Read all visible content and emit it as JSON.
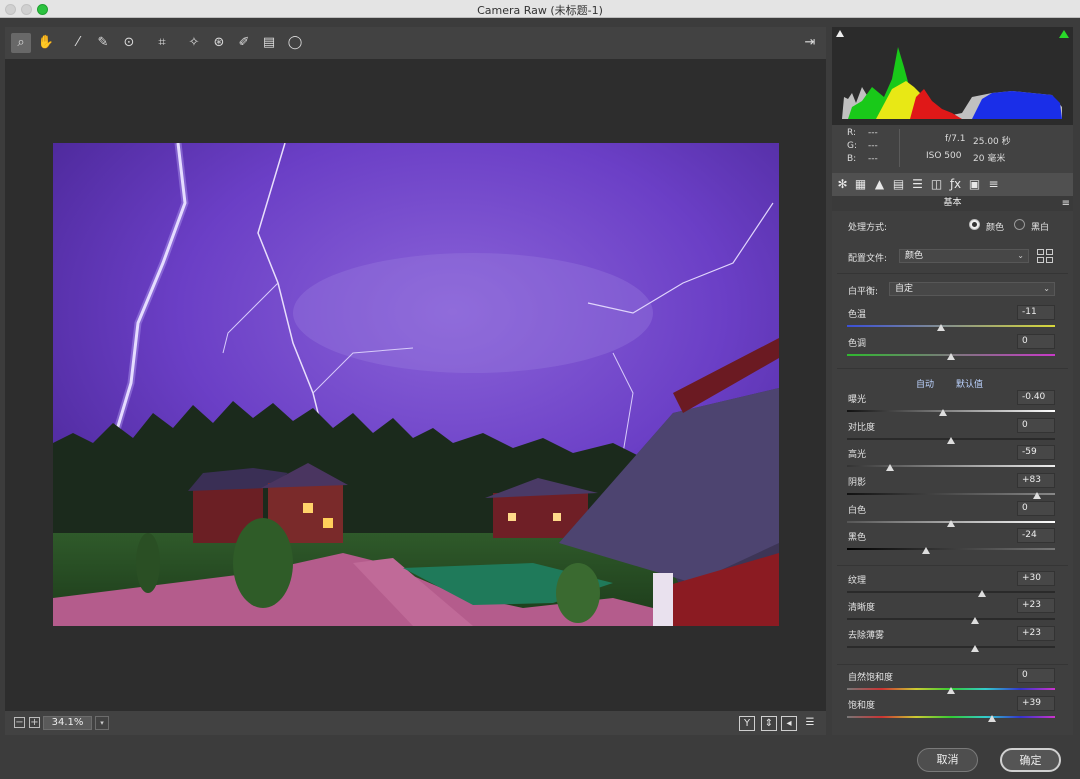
{
  "window": {
    "title": "Camera Raw (未标题-1)"
  },
  "tools": [
    {
      "name": "zoom-tool",
      "glyph": "⌕",
      "active": true
    },
    {
      "name": "hand-tool",
      "glyph": "✋"
    },
    {
      "name": "white-balance-tool",
      "glyph": "⁄"
    },
    {
      "name": "color-sampler-tool",
      "glyph": "✎"
    },
    {
      "name": "targeted-adjustment-tool",
      "glyph": "⊙"
    },
    {
      "name": "crop-tool",
      "glyph": "⌗"
    },
    {
      "name": "spot-removal-tool",
      "glyph": "✧"
    },
    {
      "name": "red-eye-tool",
      "glyph": "⊛"
    },
    {
      "name": "adjustment-brush-tool",
      "glyph": "✐"
    },
    {
      "name": "graduated-filter-tool",
      "glyph": "▤"
    },
    {
      "name": "radial-filter-tool",
      "glyph": "◯"
    }
  ],
  "toggle_fullscreen_glyph": "⇥",
  "bottom_bar": {
    "zoom": "34.1%",
    "zoom_out": "−",
    "zoom_in": "+",
    "dropdown": "▾"
  },
  "view_buttons": [
    "Y",
    "⇕",
    "◂",
    "☰"
  ],
  "histogram_colors": {
    "red": "#e01818",
    "green": "#19c919",
    "blue": "#1a2ee8",
    "yellow": "#e8e815",
    "white": "#e6e6e6"
  },
  "info": {
    "r_label": "R:",
    "g_label": "G:",
    "b_label": "B:",
    "r": "---",
    "g": "---",
    "b": "---",
    "aperture": "f/7.1",
    "shutter": "25.00 秒",
    "iso": "ISO 500",
    "focal": "20 毫米"
  },
  "panel_tabs": [
    "✻",
    "▦",
    "▲",
    "▤",
    "☰",
    "◫",
    "ƒx",
    "▣",
    "≡"
  ],
  "panel": {
    "section_title": "基本",
    "menu_glyph": "≡",
    "treatment_label": "处理方式:",
    "treatment_color": "颜色",
    "treatment_bw": "黑白",
    "profile_label": "配置文件:",
    "profile_value": "颜色",
    "wb_label": "白平衡:",
    "wb_value": "自定",
    "auto": "自动",
    "default": "默认值"
  },
  "sliders": [
    {
      "id": "temp",
      "label": "色温",
      "value": "-11",
      "pos": 0.45
    },
    {
      "id": "tint",
      "label": "色调",
      "value": "0",
      "pos": 0.5
    },
    {
      "id": "exposure",
      "label": "曝光",
      "value": "-0.40",
      "pos": 0.46
    },
    {
      "id": "contrast",
      "label": "对比度",
      "value": "0",
      "pos": 0.5
    },
    {
      "id": "highlights",
      "label": "高光",
      "value": "-59",
      "pos": 0.205
    },
    {
      "id": "shadows",
      "label": "阴影",
      "value": "+83",
      "pos": 0.915
    },
    {
      "id": "whites",
      "label": "白色",
      "value": "0",
      "pos": 0.5
    },
    {
      "id": "blacks",
      "label": "黑色",
      "value": "-24",
      "pos": 0.38
    },
    {
      "id": "texture",
      "label": "纹理",
      "value": "+30",
      "pos": 0.65
    },
    {
      "id": "clarity",
      "label": "清晰度",
      "value": "+23",
      "pos": 0.615
    },
    {
      "id": "dehaze",
      "label": "去除薄雾",
      "value": "+23",
      "pos": 0.615
    },
    {
      "id": "vibrance",
      "label": "自然饱和度",
      "value": "0",
      "pos": 0.5
    },
    {
      "id": "saturation",
      "label": "饱和度",
      "value": "+39",
      "pos": 0.695
    }
  ],
  "buttons": {
    "cancel": "取消",
    "ok": "确定"
  }
}
